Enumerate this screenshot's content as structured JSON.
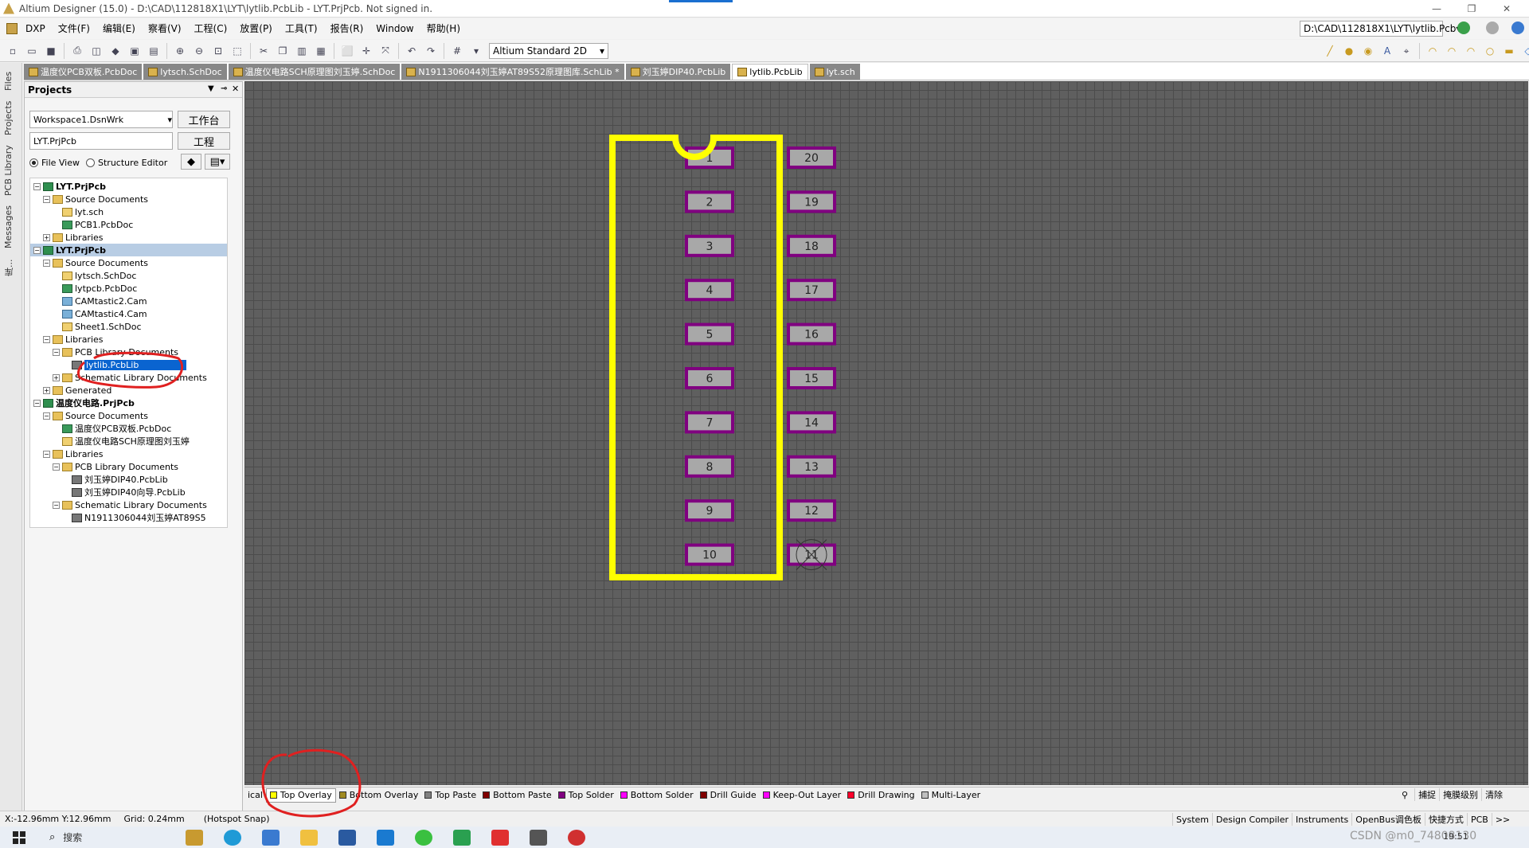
{
  "window": {
    "title": "Altium Designer (15.0) - D:\\CAD\\112818X1\\LYT\\lytlib.PcbLib - LYT.PrjPcb. Not signed in.",
    "path_combo": "D:\\CAD\\112818X1\\LYT\\lytlib.Pcb"
  },
  "menu": {
    "items": [
      "DXP",
      "文件(F)",
      "编辑(E)",
      "察看(V)",
      "工程(C)",
      "放置(P)",
      "工具(T)",
      "报告(R)",
      "Window",
      "帮助(H)"
    ]
  },
  "toolbar": {
    "view_combo": "Altium Standard 2D"
  },
  "doc_tabs": [
    {
      "label": "温度仪PCB双板.PcbDoc",
      "active": false
    },
    {
      "label": "lytsch.SchDoc",
      "active": false
    },
    {
      "label": "温度仪电路SCH原理图刘玉婷.SchDoc",
      "active": false
    },
    {
      "label": "N1911306044刘玉婷AT89S52原理图库.SchLib *",
      "active": false
    },
    {
      "label": "刘玉婷DIP40.PcbLib",
      "active": false
    },
    {
      "label": "lytlib.PcbLib",
      "active": true
    },
    {
      "label": "lyt.sch",
      "active": false
    }
  ],
  "left_strip": [
    "Files",
    "Projects",
    "PCB Library",
    "Messages",
    "库..."
  ],
  "projects": {
    "title": "Projects",
    "workspace": "Workspace1.DsnWrk",
    "workspace_btn": "工作台",
    "project": "LYT.PrjPcb",
    "project_btn": "工程",
    "view_file": "File View",
    "view_structure": "Structure Editor",
    "tree": [
      {
        "label": "LYT.PrjPcb",
        "level": 0,
        "exp": "-",
        "icon": "prj",
        "bold": true
      },
      {
        "label": "Source Documents",
        "level": 1,
        "exp": "-",
        "icon": "folder"
      },
      {
        "label": "lyt.sch",
        "level": 2,
        "icon": "sch"
      },
      {
        "label": "PCB1.PcbDoc",
        "level": 2,
        "icon": "pcb"
      },
      {
        "label": "Libraries",
        "level": 1,
        "exp": "+",
        "icon": "folder"
      },
      {
        "label": "LYT.PrjPcb",
        "level": 0,
        "exp": "-",
        "icon": "prj",
        "bold": true,
        "selected_row": true
      },
      {
        "label": "Source Documents",
        "level": 1,
        "exp": "-",
        "icon": "folder"
      },
      {
        "label": "lytsch.SchDoc",
        "level": 2,
        "icon": "sch"
      },
      {
        "label": "lytpcb.PcbDoc",
        "level": 2,
        "icon": "pcb"
      },
      {
        "label": "CAMtastic2.Cam",
        "level": 2,
        "icon": "cam"
      },
      {
        "label": "CAMtastic4.Cam",
        "level": 2,
        "icon": "cam"
      },
      {
        "label": "Sheet1.SchDoc",
        "level": 2,
        "icon": "sch"
      },
      {
        "label": "Libraries",
        "level": 1,
        "exp": "-",
        "icon": "folder"
      },
      {
        "label": "PCB Library Documents",
        "level": 2,
        "exp": "-",
        "icon": "folder"
      },
      {
        "label": "lytlib.PcbLib",
        "level": 3,
        "icon": "lib",
        "highlight": true
      },
      {
        "label": "Schematic Library Documents",
        "level": 2,
        "exp": "+",
        "icon": "folder"
      },
      {
        "label": "Generated",
        "level": 1,
        "exp": "+",
        "icon": "folder"
      },
      {
        "label": "温度仪电路.PrjPcb",
        "level": 0,
        "exp": "-",
        "icon": "prj",
        "bold": true
      },
      {
        "label": "Source Documents",
        "level": 1,
        "exp": "-",
        "icon": "folder"
      },
      {
        "label": "温度仪PCB双板.PcbDoc",
        "level": 2,
        "icon": "pcb"
      },
      {
        "label": "温度仪电路SCH原理图刘玉婷",
        "level": 2,
        "icon": "sch"
      },
      {
        "label": "Libraries",
        "level": 1,
        "exp": "-",
        "icon": "folder"
      },
      {
        "label": "PCB Library Documents",
        "level": 2,
        "exp": "-",
        "icon": "folder"
      },
      {
        "label": "刘玉婷DIP40.PcbLib",
        "level": 3,
        "icon": "lib"
      },
      {
        "label": "刘玉婷DIP40向导.PcbLib",
        "level": 3,
        "icon": "lib"
      },
      {
        "label": "Schematic Library Documents",
        "level": 2,
        "exp": "-",
        "icon": "folder"
      },
      {
        "label": "N1911306044刘玉婷AT89S5",
        "level": 3,
        "icon": "lib"
      }
    ]
  },
  "footprint": {
    "pins_left": [
      "1",
      "2",
      "3",
      "4",
      "5",
      "6",
      "7",
      "8",
      "9",
      "10"
    ],
    "pins_right": [
      "20",
      "19",
      "18",
      "17",
      "16",
      "15",
      "14",
      "13",
      "12",
      "11"
    ]
  },
  "layers": [
    {
      "label": "ical",
      "color": "#f0f0f0"
    },
    {
      "label": "Top Overlay",
      "color": "#ffff00",
      "active": true
    },
    {
      "label": "Bottom Overlay",
      "color": "#a08a20"
    },
    {
      "label": "Top Paste",
      "color": "#808080"
    },
    {
      "label": "Bottom Paste",
      "color": "#800000"
    },
    {
      "label": "Top Solder",
      "color": "#800080"
    },
    {
      "label": "Bottom Solder",
      "color": "#ff00ff"
    },
    {
      "label": "Drill Guide",
      "color": "#800000"
    },
    {
      "label": "Keep-Out Layer",
      "color": "#ff00ff"
    },
    {
      "label": "Drill Drawing",
      "color": "#ff002a"
    },
    {
      "label": "Multi-Layer",
      "color": "#c0c0c0"
    }
  ],
  "layer_right": [
    "捕捉",
    "掩膜级别",
    "清除"
  ],
  "status": {
    "coords": "X:-12.96mm Y:12.96mm",
    "grid": "Grid: 0.24mm",
    "snap": "(Hotspot Snap)",
    "buttons": [
      "System",
      "Design Compiler",
      "Instruments",
      "OpenBus调色板",
      "快捷方式",
      "PCB",
      ">>"
    ]
  },
  "taskbar": {
    "search": "搜索",
    "watermark": "CSDN @m0_74808130",
    "time": "19:51"
  }
}
